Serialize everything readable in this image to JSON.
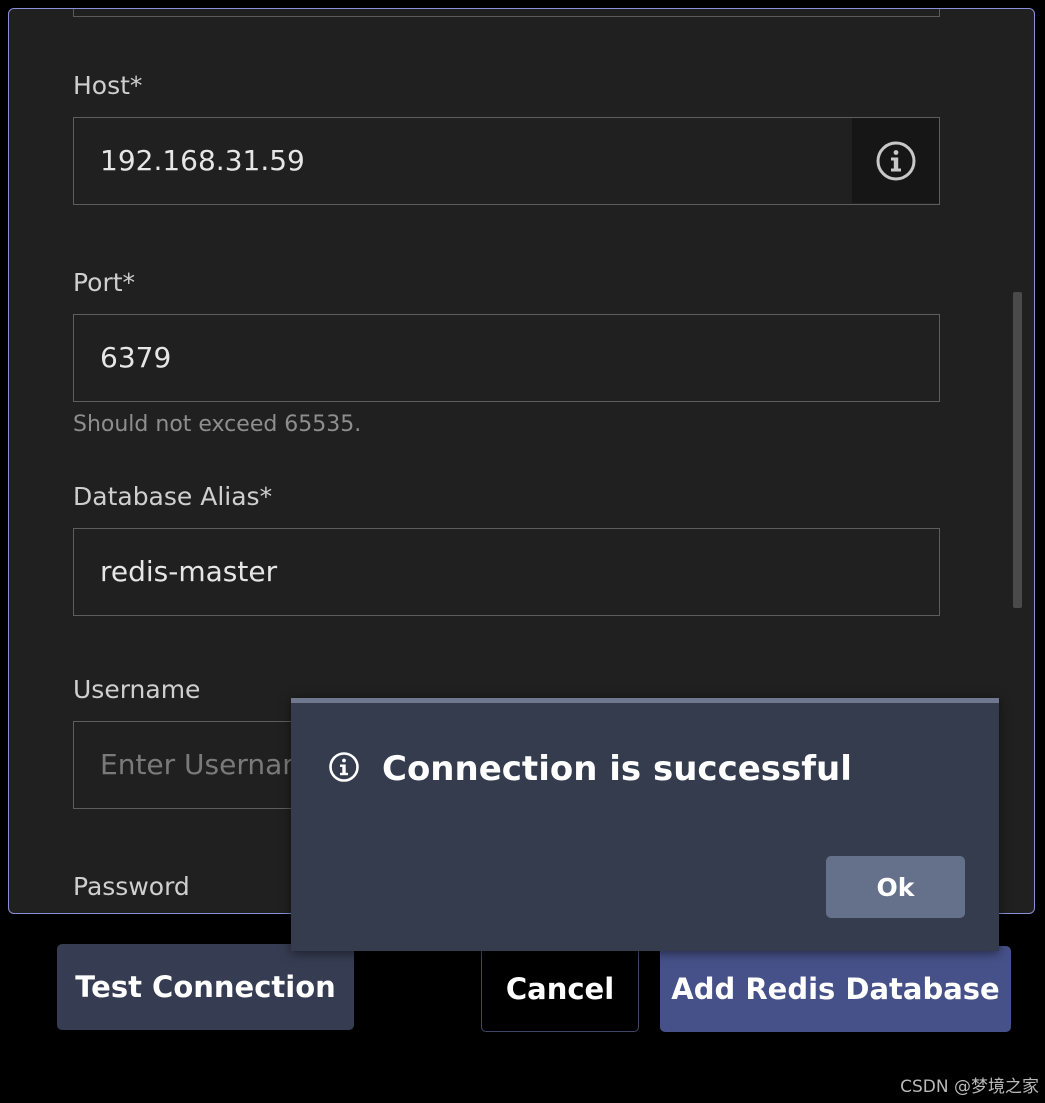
{
  "form": {
    "host": {
      "label": "Host*",
      "value": "192.168.31.59"
    },
    "port": {
      "label": "Port*",
      "value": "6379",
      "hint": "Should not exceed 65535."
    },
    "alias": {
      "label": "Database Alias*",
      "value": "redis-master"
    },
    "username": {
      "label": "Username",
      "placeholder": "Enter Usernam"
    },
    "password": {
      "label": "Password"
    }
  },
  "buttons": {
    "test_connection": "Test Connection",
    "cancel": "Cancel",
    "add_database": "Add Redis Database"
  },
  "toast": {
    "icon": "info-icon",
    "title": "Connection is successful",
    "ok_label": "Ok"
  },
  "watermark": "CSDN @梦境之家",
  "colors": {
    "panel_bg": "#202020",
    "panel_border": "#8a90d8",
    "toast_bg": "#353c4e",
    "primary_button": "#465189",
    "secondary_button": "#363d52"
  }
}
